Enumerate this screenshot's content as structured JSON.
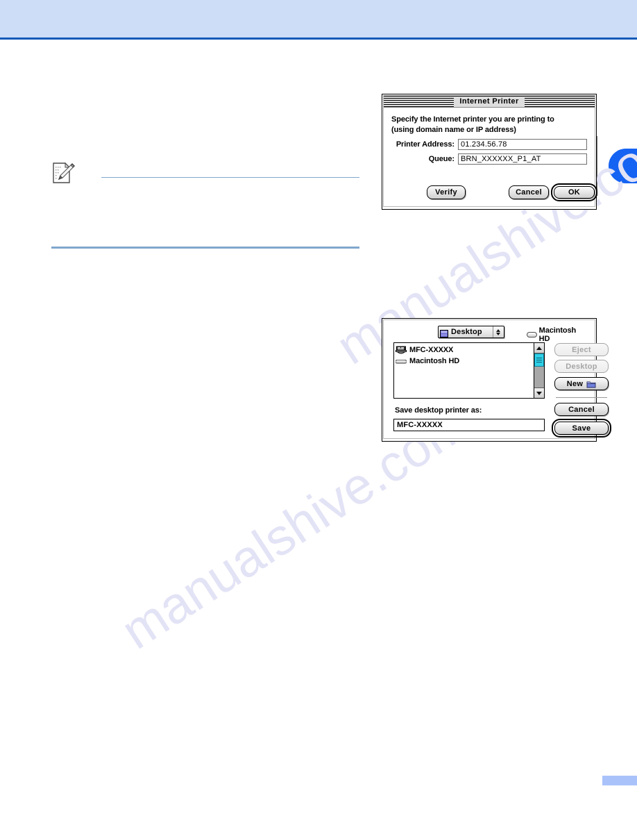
{
  "page": {
    "header_band_color": "#cddcf7",
    "header_rule_color": "#1059b8",
    "chapter_tab_color": "#1563f2",
    "footer_box_color": "#a9c3fa",
    "watermark_text": "manualshive.com"
  },
  "note": {
    "icon": "note-pencil-icon"
  },
  "internet_printer_dialog": {
    "title": "Internet Printer",
    "prompt_line1": "Specify the Internet printer you are printing to",
    "prompt_line2": "(using domain name or IP address)",
    "fields": [
      {
        "label": "Printer Address:",
        "value": "01.234.56.78"
      },
      {
        "label": "Queue:",
        "value": "BRN_XXXXXX_P1_AT"
      }
    ],
    "buttons": {
      "verify": "Verify",
      "cancel": "Cancel",
      "ok": "OK"
    }
  },
  "save_printer_dialog": {
    "location_popup": {
      "value": "Desktop",
      "icon": "desktop-icon"
    },
    "volume": {
      "label": "Macintosh HD",
      "icon": "hard-disk-icon"
    },
    "file_list": [
      {
        "label": "MFC-XXXXX",
        "icon": "printer-icon"
      },
      {
        "label": "Macintosh HD",
        "icon": "hard-disk-icon"
      }
    ],
    "saveas_label": "Save desktop printer as:",
    "saveas_value": "MFC-XXXXX",
    "buttons": {
      "eject": "Eject",
      "desktop": "Desktop",
      "new": "New",
      "cancel": "Cancel",
      "save": "Save"
    }
  }
}
